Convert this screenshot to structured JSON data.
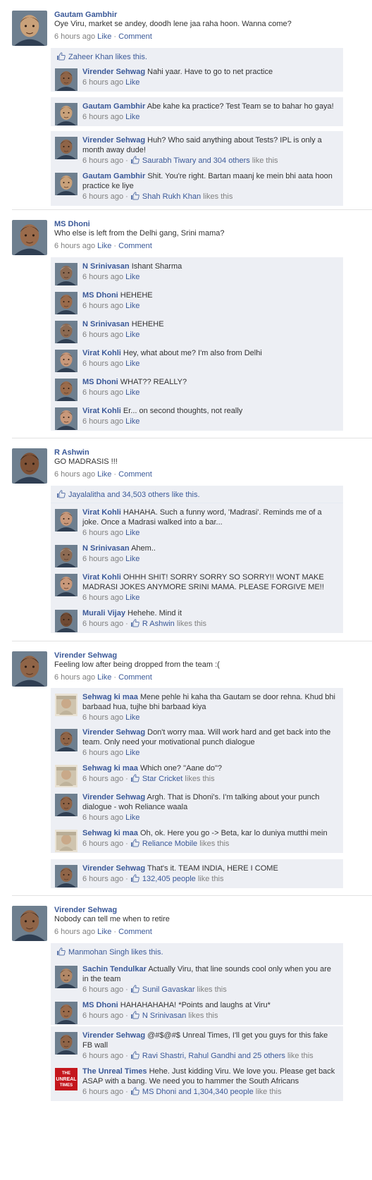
{
  "labels": {
    "like": "Like",
    "comment": "Comment",
    "sep": "·"
  },
  "posts": [
    {
      "author": "Gautam Gambhir",
      "text": "Oye Viru, market se andey, doodh lene jaa raha hoon. Wanna come?",
      "time": "6 hours ago",
      "likes": "Zaheer Khan likes this.",
      "comments": [
        {
          "author": "Virender Sehwag",
          "text": "Nahi yaar. Have to go to net practice",
          "time": "6 hours ago",
          "likes": ""
        },
        {
          "author": "Gautam Gambhir",
          "text": "Abe kahe ka practice? Test Team se to bahar ho gaya!",
          "time": "6 hours ago",
          "likes": ""
        },
        {
          "author": "Virender Sehwag",
          "text": "Huh? Who said anything about Tests? IPL is only a month away dude!",
          "time": "6 hours ago",
          "likes_link": "Saurabh Tiwary and 304 others",
          "likes_tail": " like this"
        },
        {
          "author": "Gautam Gambhir",
          "text": "Shit. You're right. Bartan maanj ke mein bhi aata hoon practice ke liye",
          "time": "6 hours ago",
          "likes_link": "Shah Rukh Khan",
          "likes_tail": " likes this"
        }
      ]
    },
    {
      "author": "MS Dhoni",
      "text": "Who else is left from the Delhi gang, Srini mama?",
      "time": "6 hours ago",
      "likes": "",
      "comments": [
        {
          "author": "N Srinivasan",
          "text": "Ishant Sharma",
          "time": "6 hours ago"
        },
        {
          "author": "MS Dhoni",
          "text": "HEHEHE",
          "time": "6 hours ago"
        },
        {
          "author": "N Srinivasan",
          "text": "HEHEHE",
          "time": "6 hours ago"
        },
        {
          "author": "Virat Kohli",
          "text": "Hey, what about me? I'm also from Delhi",
          "time": "6 hours ago"
        },
        {
          "author": "MS Dhoni",
          "text": "WHAT?? REALLY?",
          "time": "6 hours ago"
        },
        {
          "author": "Virat Kohli",
          "text": "Er... on second thoughts, not really",
          "time": "6 hours ago"
        }
      ]
    },
    {
      "author": "R Ashwin",
      "text": "GO MADRASIS !!!",
      "time": "6 hours ago",
      "likes": "Jayalalitha and 34,503 others like this.",
      "comments": [
        {
          "author": "Virat Kohli",
          "text": "HAHAHA. Such a funny word, 'Madrasi'. Reminds me of a joke. Once a Madrasi walked into a bar...",
          "time": "6 hours ago"
        },
        {
          "author": "N Srinivasan",
          "text": "Ahem..",
          "time": "6 hours ago"
        },
        {
          "author": "Virat Kohli",
          "text": "OHHH SHIT! SORRY SORRY SO SORRY!! WONT MAKE MADRASI JOKES ANYMORE SRINI MAMA. PLEASE FORGIVE ME!!",
          "time": "6 hours ago"
        },
        {
          "author": "Murali Vijay",
          "text": "Hehehe. Mind it",
          "time": "6 hours ago",
          "likes_link": "R Ashwin",
          "likes_tail": " likes this"
        }
      ]
    },
    {
      "author": "Virender Sehwag",
      "text": "Feeling low after being dropped from the team :(",
      "time": "6 hours ago",
      "likes": "",
      "comments": [
        {
          "author": "Sehwag ki maa",
          "text": "Mene pehle hi kaha tha Gautam se door rehna. Khud bhi barbaad hua, tujhe bhi barbaad kiya",
          "time": "6 hours ago"
        },
        {
          "author": "Virender Sehwag",
          "text": "Don't worry maa. Will work hard and get back into the team. Only need your motivational punch dialogue",
          "time": "6 hours ago"
        },
        {
          "author": "Sehwag ki maa",
          "text": "Which one? \"Aane do\"?",
          "time": "6 hours ago",
          "likes_link": "Star Cricket",
          "likes_tail": " likes this"
        },
        {
          "author": "Virender Sehwag",
          "text": "Argh. That is Dhoni's. I'm talking about your punch dialogue - woh Reliance waala",
          "time": "6 hours ago"
        },
        {
          "author": "Sehwag ki maa",
          "text": "Oh, ok. Here you go -> Beta, kar lo duniya mutthi mein",
          "time": "6 hours ago",
          "likes_link": "Reliance Mobile",
          "likes_tail": " likes this"
        },
        {
          "author": "Virender Sehwag",
          "text": "That's it. TEAM INDIA, HERE I COME",
          "time": "6 hours ago",
          "likes_link": "132,405 people",
          "likes_tail": " like this"
        }
      ]
    },
    {
      "author": "Virender Sehwag",
      "text": "Nobody can tell me when to retire",
      "time": "6 hours ago",
      "likes": "Manmohan Singh likes this.",
      "comments": [
        {
          "author": "Sachin Tendulkar",
          "text": "Actually Viru, that line sounds cool only when you are in the team",
          "time": "6 hours ago",
          "likes_link": "Sunil Gavaskar",
          "likes_tail": " likes this"
        },
        {
          "author": "MS Dhoni",
          "text": "HAHAHAHAHA! *Points and laughs at Viru*",
          "time": "6 hours ago",
          "likes_link": "N Srinivasan",
          "likes_tail": " likes this"
        },
        {
          "author": "Virender Sehwag",
          "text": "@#$@#$ Unreal Times, I'll get you guys for this fake FB wall",
          "time": "6 hours ago",
          "likes_link": "Ravi Shastri, Rahul Gandhi and 25 others",
          "likes_tail": " like this"
        },
        {
          "author": "The Unreal Times",
          "text": "Hehe. Just kidding Viru. We love you. Please get back ASAP with a bang. We need you to hammer the South Africans",
          "time": "6 hours ago",
          "likes_link": "MS Dhoni and 1,304,340 people",
          "likes_tail": " like this"
        }
      ]
    }
  ],
  "logo_text": [
    "THE",
    "UNREAL",
    "TIMES"
  ]
}
